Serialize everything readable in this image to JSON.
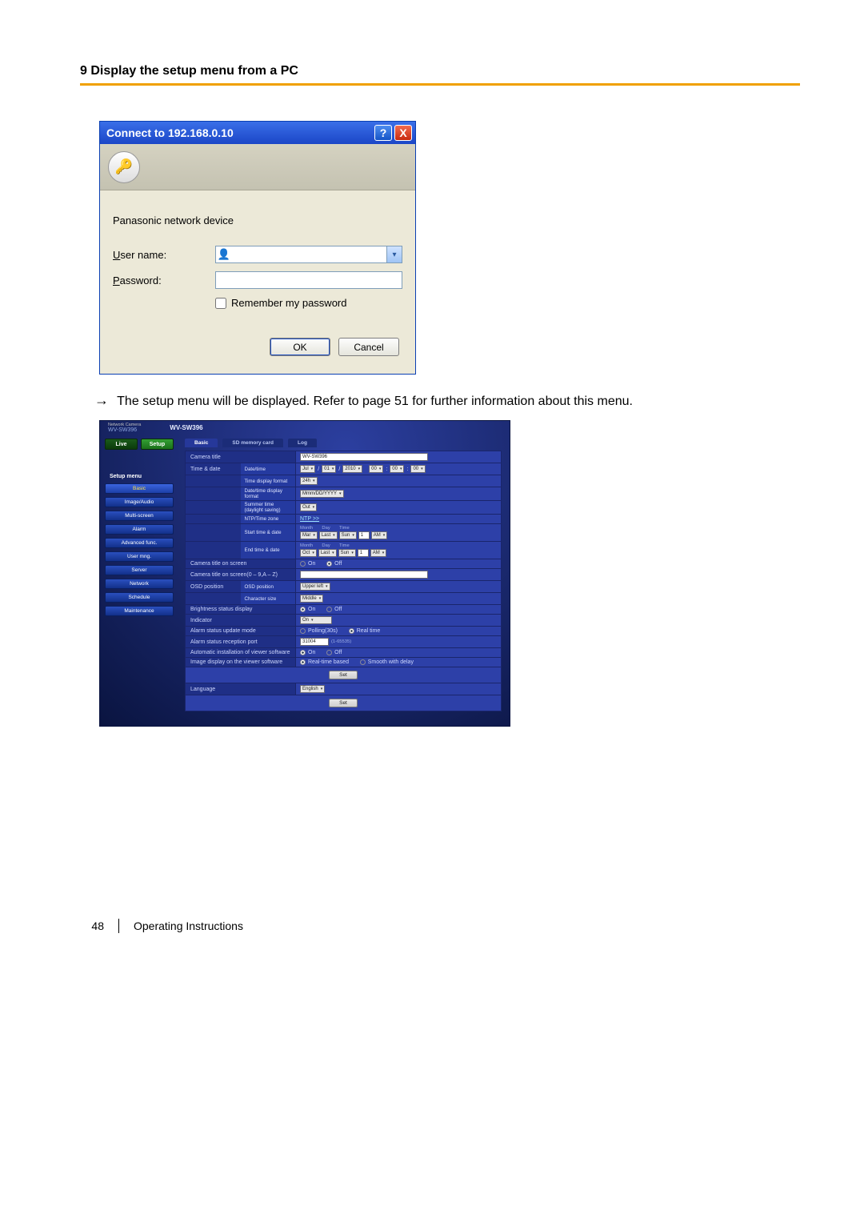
{
  "section": {
    "title": "9 Display the setup menu from a PC"
  },
  "dialog": {
    "title": "Connect to 192.168.0.10",
    "realm": "Panasonic network device",
    "user_label_pre": "U",
    "user_label_rest": "ser name:",
    "pass_label_pre": "P",
    "pass_label_rest": "assword:",
    "remember_pre": "R",
    "remember_rest": "emember my password",
    "ok": "OK",
    "cancel": "Cancel",
    "user_value": "",
    "pass_value": ""
  },
  "result": {
    "arrow": "→",
    "text": "The setup menu will be displayed. Refer to page 51 for further information about this menu."
  },
  "setup": {
    "model_tag": "Network Camera",
    "model_small": "WV-SW396",
    "model_bold": "WV-SW396",
    "live_tab": "Live",
    "setup_tab": "Setup",
    "side_title": "Setup menu",
    "menu": [
      "Basic",
      "Image/Audio",
      "Multi-screen",
      "Alarm",
      "Advanced func.",
      "User mng.",
      "Server",
      "Network",
      "Schedule",
      "Maintenance"
    ],
    "tabs": [
      "Basic",
      "SD memory card",
      "Log"
    ],
    "camera_title_label": "Camera title",
    "camera_title_value": "WV-SW396",
    "time_date_group": "Time & date",
    "rows": {
      "date_time": {
        "label": "Date/time",
        "month": "Jul",
        "d": "01",
        "y": "2010",
        "hh": "00",
        "mm": "00",
        "ss": "00",
        "slash": "/"
      },
      "tdf": {
        "label": "Time display format",
        "value": "24h"
      },
      "dtf": {
        "label": "Date/time display format",
        "value": "Mmm/DD/YYYY"
      },
      "summer": {
        "label": "Summer time (daylight saving)",
        "value": "Out"
      },
      "ntp": {
        "label": "NTP/Time zone",
        "value": "NTP >>"
      },
      "start": {
        "label": "Start time & date",
        "hdr_m": "Month",
        "hdr_d": "Day",
        "hdr_t": "Time",
        "m": "Mar",
        "w": "Last",
        "dw": "Sun",
        "h": "1",
        "ap": "AM"
      },
      "end": {
        "label": "End time & date",
        "m": "Oct",
        "w": "Last",
        "dw": "Sun",
        "h": "1",
        "ap": "AM"
      }
    },
    "cam_title_on_screen": {
      "label": "Camera title on screen",
      "on": "On",
      "off": "Off"
    },
    "cam_title_input": {
      "label": "Camera title on screen(0 – 9,A – Z)",
      "value": ""
    },
    "osd_group": "OSD position",
    "osd_pos": {
      "label": "OSD position",
      "value": "Upper left"
    },
    "char_size": {
      "label": "Character size",
      "value": "Middle"
    },
    "brightness": {
      "label": "Brightness status display",
      "on": "On",
      "off": "Off"
    },
    "indicator": {
      "label": "Indicator",
      "value": "On"
    },
    "alarm_mode": {
      "label": "Alarm status update mode",
      "poll": "Polling(30s)",
      "real": "Real time"
    },
    "alarm_port": {
      "label": "Alarm status reception port",
      "value": "31004",
      "hint": "(1-65535)"
    },
    "auto_install": {
      "label": "Automatic installation of viewer software",
      "on": "On",
      "off": "Off"
    },
    "image_disp": {
      "label": "Image display on the viewer software",
      "rt": "Real-time based",
      "smooth": "Smooth with delay"
    },
    "language": {
      "label": "Language",
      "value": "English"
    },
    "set": "Set"
  },
  "footer": {
    "page": "48",
    "doc": "Operating Instructions"
  }
}
